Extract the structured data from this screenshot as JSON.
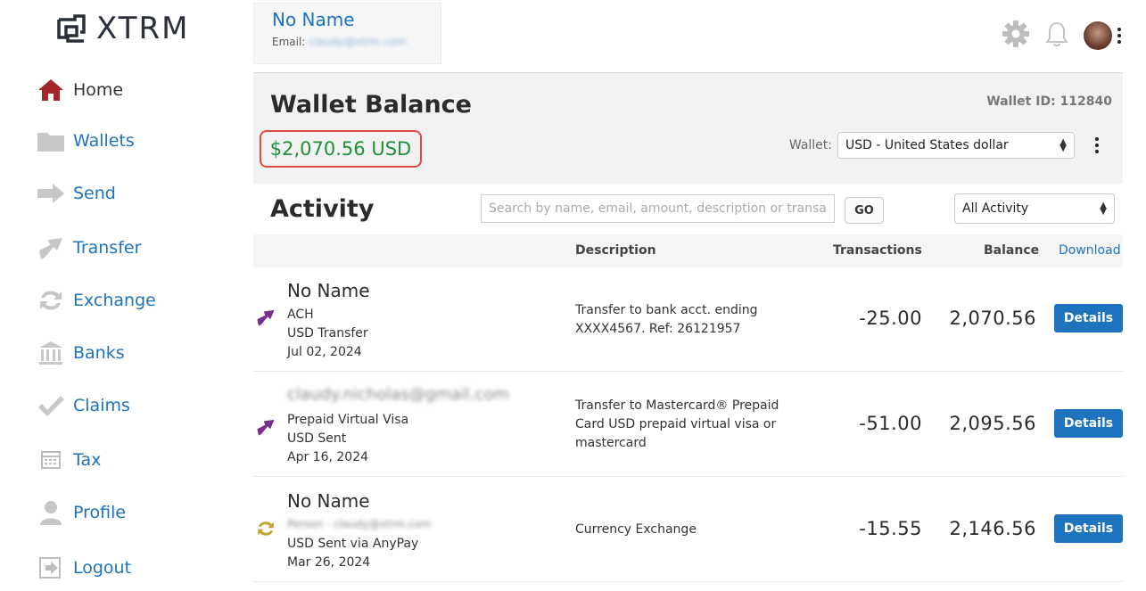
{
  "app": {
    "logo_text": "XTRM"
  },
  "sidebar": {
    "items": [
      {
        "label": "Home",
        "icon": "home-icon",
        "active": true
      },
      {
        "label": "Wallets",
        "icon": "folder-icon"
      },
      {
        "label": "Send",
        "icon": "send-arrow-icon"
      },
      {
        "label": "Transfer",
        "icon": "transfer-arrow-icon"
      },
      {
        "label": "Exchange",
        "icon": "exchange-icon"
      },
      {
        "label": "Banks",
        "icon": "bank-icon"
      },
      {
        "label": "Claims",
        "icon": "checkmark-icon"
      },
      {
        "label": "Tax",
        "icon": "calculator-icon"
      },
      {
        "label": "Profile",
        "icon": "user-icon"
      },
      {
        "label": "Logout",
        "icon": "logout-icon"
      }
    ]
  },
  "profile": {
    "name": "No Name",
    "email_label": "Email:",
    "email_value": "claudy@xtrm.com"
  },
  "wallet": {
    "title": "Wallet Balance",
    "wallet_id_label": "Wallet ID: 112840",
    "balance": "$2,070.56 USD",
    "select_label": "Wallet:",
    "selected_wallet": "USD - United States dollar"
  },
  "activity": {
    "title": "Activity",
    "search_placeholder": "Search by name, email, amount, description or transa",
    "go_label": "GO",
    "filter_value": "All Activity",
    "columns": {
      "description": "Description",
      "transactions": "Transactions",
      "balance": "Balance",
      "download": "Download"
    },
    "rows": [
      {
        "name": "No Name",
        "line1": "ACH",
        "line2": "USD Transfer",
        "date": "Jul 02, 2024",
        "description": "Transfer to bank acct. ending XXXX4567. Ref: 26121957",
        "amount": "-25.00",
        "balance": "2,070.56",
        "details_label": "Details",
        "icon": "transfer-arrow-icon"
      },
      {
        "name": "claudy.nicholas@gmail.com",
        "line1": "Prepaid Virtual Visa",
        "line2": "USD Sent",
        "date": "Apr 16, 2024",
        "description": "Transfer to Mastercard® Prepaid Card USD prepaid virtual visa or mastercard",
        "amount": "-51.00",
        "balance": "2,095.56",
        "details_label": "Details",
        "icon": "transfer-arrow-icon"
      },
      {
        "name": "No Name",
        "line1": "Person - claudy@xtrm.com",
        "line2": "USD Sent via AnyPay",
        "date": "Mar 26, 2024",
        "description": "Currency Exchange",
        "amount": "-15.55",
        "balance": "2,146.56",
        "details_label": "Details",
        "icon": "exchange-icon"
      }
    ]
  },
  "colors": {
    "link_blue": "#1e73be",
    "balance_green": "#1f8f3a",
    "highlight_red": "#e04a3f",
    "purple_icon": "#7b2d8e",
    "gold_icon": "#c8a230",
    "home_red": "#a3262a"
  }
}
